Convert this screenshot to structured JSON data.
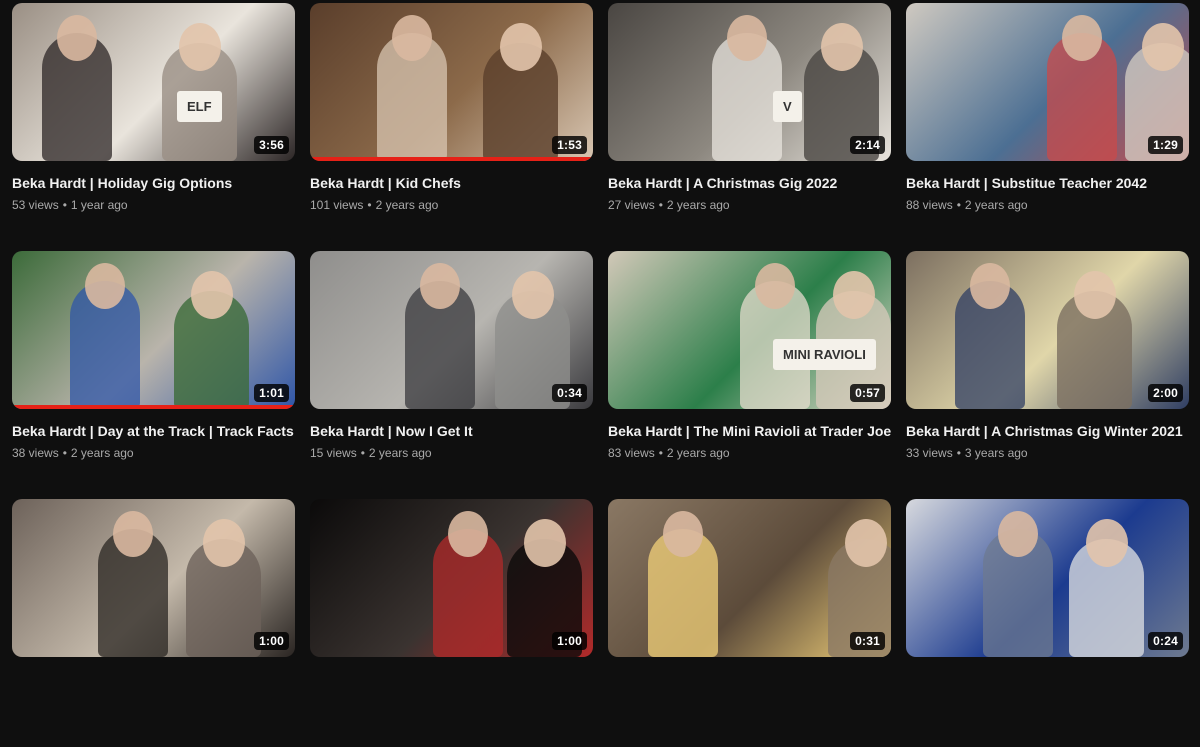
{
  "videos": [
    {
      "title": "Beka Hardt | Holiday Gig Options",
      "views": "53 views",
      "age": "1 year ago",
      "duration": "3:56",
      "progress": 0,
      "colors": [
        "#9a8f84",
        "#e9e4dc",
        "#2c2626"
      ],
      "sign_text": "ELF"
    },
    {
      "title": "Beka Hardt | Kid Chefs",
      "views": "101 views",
      "age": "2 years ago",
      "duration": "1:53",
      "progress": 1.0,
      "colors": [
        "#5a3e2b",
        "#8c6a4a",
        "#d8c6b2"
      ]
    },
    {
      "title": "Beka Hardt | A Christmas Gig 2022",
      "views": "27 views",
      "age": "2 years ago",
      "duration": "2:14",
      "progress": 0,
      "colors": [
        "#4a4642",
        "#8d8880",
        "#e8e4dd"
      ],
      "sign_text": "V"
    },
    {
      "title": "Beka Hardt | Substitue Teacher 2042",
      "views": "88 views",
      "age": "2 years ago",
      "duration": "1:29",
      "progress": 0,
      "colors": [
        "#cfc9c0",
        "#4c6f93",
        "#c94a4a"
      ]
    },
    {
      "title": "Beka Hardt | Day at the Track | Track Facts",
      "views": "38 views",
      "age": "2 years ago",
      "duration": "1:01",
      "progress": 1.0,
      "colors": [
        "#3c6b3a",
        "#b9b4ab",
        "#2f56a8"
      ]
    },
    {
      "title": "Beka Hardt | Now I Get It",
      "views": "15 views",
      "age": "2 years ago",
      "duration": "0:34",
      "progress": 0,
      "colors": [
        "#8f8e8c",
        "#b7b5b0",
        "#3a3a3e"
      ]
    },
    {
      "title": "Beka Hardt | The Mini Ravioli at Trader Joe's",
      "views": "83 views",
      "age": "2 years ago",
      "duration": "0:57",
      "progress": 0,
      "colors": [
        "#d2c8b8",
        "#2c7f4a",
        "#e6dccd"
      ],
      "sign_text": "MINI RAVIOLI"
    },
    {
      "title": "Beka Hardt | A Christmas Gig Winter 2021",
      "views": "33 views",
      "age": "3 years ago",
      "duration": "2:00",
      "progress": 0,
      "colors": [
        "#7c6f60",
        "#e0d6a9",
        "#2f3e63"
      ]
    },
    {
      "title": "",
      "views": "",
      "age": "",
      "duration": "1:00",
      "progress": 0,
      "colors": [
        "#6d625a",
        "#c4b9aa",
        "#2a2522"
      ]
    },
    {
      "title": "",
      "views": "",
      "age": "",
      "duration": "1:00",
      "progress": 0,
      "colors": [
        "#0b0a0a",
        "#3a3330",
        "#b22a2a"
      ]
    },
    {
      "title": "",
      "views": "",
      "age": "",
      "duration": "0:31",
      "progress": 0,
      "colors": [
        "#8a7864",
        "#5c4b3a",
        "#f3d27a"
      ]
    },
    {
      "title": "",
      "views": "",
      "age": "",
      "duration": "0:24",
      "progress": 0,
      "colors": [
        "#d7d9de",
        "#1c3b8f",
        "#6e7a90"
      ]
    }
  ]
}
